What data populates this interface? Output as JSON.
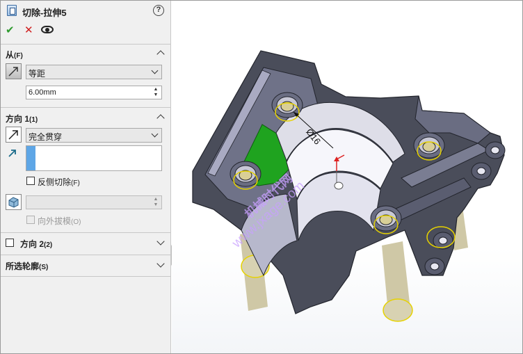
{
  "panel": {
    "title": "切除-拉伸5",
    "help_symbol": "?",
    "actions": {
      "ok_symbol": "✔",
      "cancel_symbol": "✕"
    },
    "from": {
      "header": "从",
      "header_hotkey": "(F)",
      "condition": "等距",
      "offset_value": "6.00mm"
    },
    "direction1": {
      "header": "方向 1",
      "header_hotkey": "(1)",
      "end_condition": "完全贯穿",
      "flip_side_label": "反侧切除",
      "flip_side_hotkey": "(F)",
      "flip_side_checked": false,
      "draft_outward_label": "向外拔模",
      "draft_outward_hotkey": "(O)"
    },
    "direction2": {
      "header": "方向 2",
      "header_hotkey": "(2)",
      "checked": false
    },
    "selected_contours": {
      "header": "所选轮廓",
      "header_hotkey": "(S)"
    }
  },
  "viewport": {
    "dimension_label": "Ø16",
    "watermark_cn": "机械时代网",
    "watermark_url": "www.jxage.com",
    "colors": {
      "body": "#4a4d5a",
      "body_light": "#8d90a8",
      "face_highlight": "#e9e9f4",
      "selected_face": "#1fa31f",
      "selection_ring": "#e6d200",
      "pins": "#c9c2a0"
    }
  }
}
